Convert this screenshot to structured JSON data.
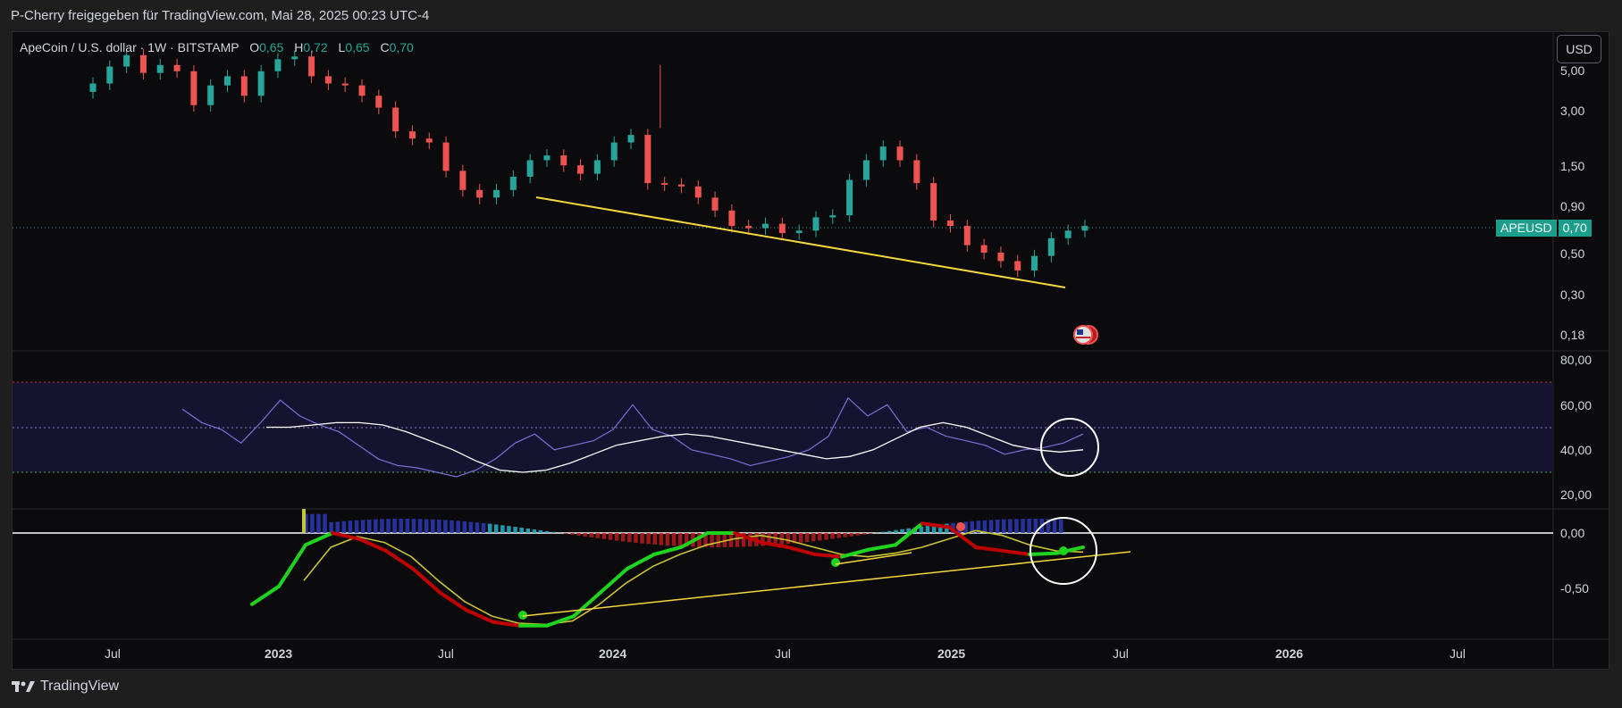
{
  "header": {
    "published_text": "P-Cherry freigegeben für TradingView.com, Mai 28, 2025 00:23 UTC-4"
  },
  "symbol": {
    "name": "ApeCoin / U.S. dollar · 1W · BITSTAMP",
    "open_label": "O",
    "open_value": "0,65",
    "high_label": "H",
    "high_value": "0,72",
    "low_label": "L",
    "low_value": "0,65",
    "close_label": "C",
    "close_value": "0,70"
  },
  "currency_button": "USD",
  "price_tag": {
    "ticker": "APEUSD",
    "value": "0,70"
  },
  "footer": {
    "brand": "TradingView"
  },
  "colors": {
    "up": "#26a69a",
    "down": "#ef5350",
    "trendline": "#f5d63d",
    "rsi_line": "#7e6fd6",
    "rsi_ma": "#ffffff",
    "macd_up": "#1ed41e",
    "macd_down": "#c00000",
    "overbought": "#d32f2f",
    "oversold": "#4caf50"
  },
  "chart_data": [
    {
      "type": "candlestick",
      "title": "ApeCoin / U.S. dollar · 1W · BITSTAMP",
      "yscale": "log",
      "y_ticks": [
        "5,00",
        "3,00",
        "1,50",
        "0,90",
        "0,50",
        "0,30",
        "0,18"
      ],
      "x_ticks": [
        "Jul",
        "2023",
        "Jul",
        "2024",
        "Jul",
        "2025",
        "Jul",
        "2026",
        "Jul"
      ],
      "last_close": 0.7,
      "candles_approx_close": [
        4.2,
        5.2,
        6.0,
        4.8,
        5.3,
        4.9,
        3.2,
        4.1,
        4.6,
        3.6,
        4.9,
        5.7,
        5.9,
        4.6,
        4.2,
        4.1,
        3.6,
        3.1,
        2.3,
        2.1,
        2.0,
        1.4,
        1.1,
        1.0,
        1.1,
        1.3,
        1.6,
        1.7,
        1.5,
        1.35,
        1.6,
        2.0,
        2.2,
        1.2,
        1.18,
        1.15,
        1.0,
        0.85,
        0.7,
        0.68,
        0.72,
        0.64,
        0.66,
        0.78,
        0.8,
        1.25,
        1.6,
        1.9,
        1.6,
        1.2,
        0.75,
        0.7,
        0.55,
        0.5,
        0.45,
        0.4,
        0.48,
        0.6,
        0.66,
        0.7
      ],
      "trendline": {
        "from": {
          "date": "2023-10",
          "value": 1.0
        },
        "to": {
          "date": "2025-04",
          "value": 0.34
        }
      }
    },
    {
      "type": "line",
      "y_ticks": [
        "80,00",
        "60,00",
        "40,00",
        "20,00"
      ],
      "levels": [
        70,
        50,
        30
      ],
      "series_rsi": [
        58,
        52,
        49,
        43,
        52,
        62,
        55,
        51,
        48,
        42,
        36,
        33,
        32,
        30,
        28,
        31,
        36,
        43,
        47,
        40,
        42,
        44,
        49,
        60,
        49,
        46,
        40,
        38,
        36,
        33,
        35,
        37,
        40,
        46,
        63,
        55,
        60,
        48,
        50,
        46,
        44,
        42,
        38,
        40,
        41,
        43,
        47
      ],
      "series_ma": [
        50,
        50,
        51,
        52,
        52,
        51,
        48,
        44,
        40,
        35,
        31,
        30,
        31,
        34,
        38,
        42,
        44,
        46,
        47,
        46,
        44,
        42,
        40,
        38,
        36,
        37,
        40,
        45,
        50,
        52,
        50,
        46,
        42,
        40,
        39,
        40
      ]
    },
    {
      "type": "line",
      "y_ticks": [
        "0,00",
        "-0,50"
      ],
      "series_macd": [
        -0.6,
        -0.45,
        -0.1,
        0.0,
        -0.05,
        -0.15,
        -0.3,
        -0.5,
        -0.65,
        -0.75,
        -0.78,
        -0.78,
        -0.7,
        -0.5,
        -0.3,
        -0.18,
        -0.12,
        0.0,
        0.0,
        -0.08,
        -0.12,
        -0.18,
        -0.2,
        -0.14,
        -0.1,
        0.08,
        0.05,
        -0.12,
        -0.15,
        -0.18,
        -0.17,
        -0.12
      ],
      "series_signal": [
        -0.4,
        -0.12,
        -0.03,
        -0.08,
        -0.2,
        -0.4,
        -0.58,
        -0.7,
        -0.76,
        -0.77,
        -0.74,
        -0.6,
        -0.42,
        -0.28,
        -0.18,
        -0.1,
        -0.05,
        -0.02,
        -0.06,
        -0.12,
        -0.18,
        -0.2,
        -0.17,
        -0.12,
        -0.05,
        0.02,
        -0.02,
        -0.1,
        -0.15,
        -0.16
      ]
    }
  ]
}
